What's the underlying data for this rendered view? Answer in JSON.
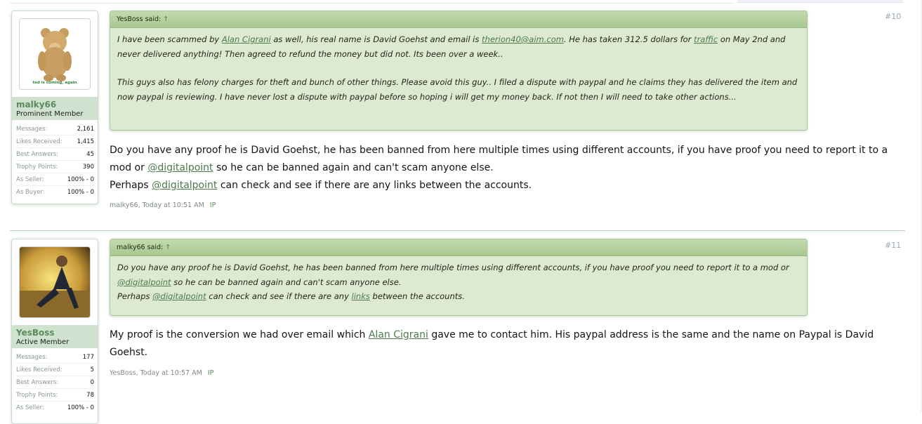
{
  "posts": [
    {
      "number": "#10",
      "user": {
        "name": "malky66",
        "title": "Prominent Member",
        "avatar_caption": "ted is coming, again",
        "stats": [
          {
            "label": "Messages:",
            "value": "2,161"
          },
          {
            "label": "Likes Received:",
            "value": "1,415"
          },
          {
            "label": "Best Answers:",
            "value": "45"
          },
          {
            "label": "Trophy Points:",
            "value": "390"
          },
          {
            "label": "As Seller:",
            "value": "100% - 0"
          },
          {
            "label": "As Buyer:",
            "value": "100% - 0"
          }
        ]
      },
      "quote": {
        "author": "YesBoss said:",
        "arrow": "↑",
        "p1_a": "I have been scammed by ",
        "p1_link1": "Alan Cigrani",
        "p1_b": " as well, his real name is David Goehst and email is ",
        "p1_link2": "therion40@aim.com",
        "p1_c": ". He has taken 312.5 dollars for ",
        "p1_link3": "traffic",
        "p1_d": " on May 2nd and never delivered anything! Then agreed to refund the money but did not. Its been over a week..",
        "p2": "This guys also has felony charges for theft and bunch of other things. Please avoid this guy.. I filed a dispute with paypal and he claims they has delivered the item and now paypal is reviewing. I have never lost a dispute with paypal before so hoping i will get my money back. If not then I will need to take other actions..."
      },
      "message": {
        "l1_a": "Do you have any proof he is David Goehst, he has been banned from here multiple times using different accounts, if you have proof you need to report it to a mod or ",
        "l1_link": "@digitalpoint",
        "l1_b": " so he can be banned again and can't scam anyone else.",
        "l2_a": "Perhaps ",
        "l2_link": "@digitalpoint",
        "l2_b": " can check and see if there are any links between the accounts."
      },
      "meta": {
        "author": "malky66",
        "time": ", Today at 10:51 AM",
        "ip": "IP"
      }
    },
    {
      "number": "#11",
      "user": {
        "name": "YesBoss",
        "title": "Active Member",
        "stats": [
          {
            "label": "Messages:",
            "value": "177"
          },
          {
            "label": "Likes Received:",
            "value": "5"
          },
          {
            "label": "Best Answers:",
            "value": "0"
          },
          {
            "label": "Trophy Points:",
            "value": "78"
          },
          {
            "label": "As Seller:",
            "value": "100% - 0"
          }
        ]
      },
      "quote": {
        "author": "malky66 said:",
        "arrow": "↑",
        "l1_a": "Do you have any proof he is David Goehst, he has been banned from here multiple times using different accounts, if you have proof you need to report it to a mod or ",
        "l1_link": "@digitalpoint",
        "l1_b": " so he can be banned again and can't scam anyone else.",
        "l2_a": "Perhaps ",
        "l2_link1": "@digitalpoint",
        "l2_b": " can check and see if there are any ",
        "l2_link2": "links",
        "l2_c": " between the accounts."
      },
      "message": {
        "a": "My proof is the conversion we had over email which ",
        "link": "Alan Cigrani",
        "b": " gave me to contact him. His paypal address is the same and the name on Paypal is David Goehst."
      },
      "meta": {
        "author": "YesBoss",
        "time": ", Today at 10:57 AM",
        "ip": "IP"
      }
    }
  ]
}
